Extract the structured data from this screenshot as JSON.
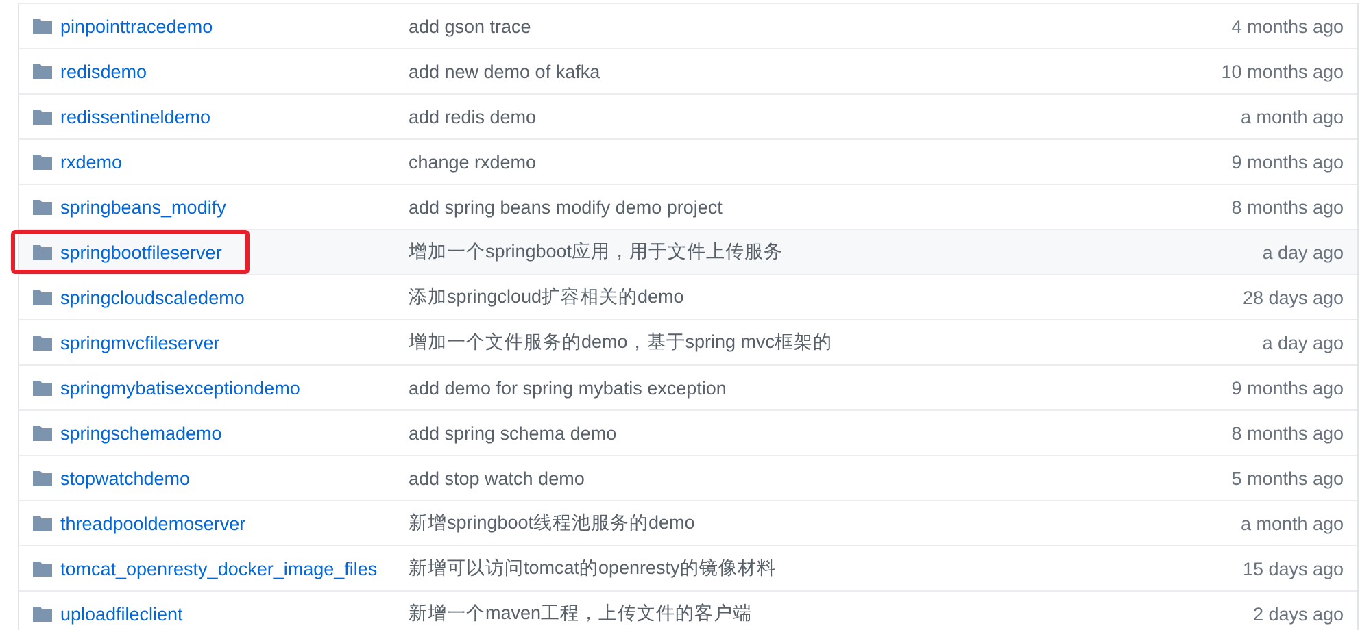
{
  "files": [
    {
      "name": "pinpointtracedemo",
      "message": "add gson trace",
      "age": "4 months ago",
      "highlighted": false,
      "boxed": false
    },
    {
      "name": "redisdemo",
      "message": "add new demo of kafka",
      "age": "10 months ago",
      "highlighted": false,
      "boxed": false
    },
    {
      "name": "redissentineldemo",
      "message": "add redis demo",
      "age": "a month ago",
      "highlighted": false,
      "boxed": false
    },
    {
      "name": "rxdemo",
      "message": "change rxdemo",
      "age": "9 months ago",
      "highlighted": false,
      "boxed": false
    },
    {
      "name": "springbeans_modify",
      "message": "add spring beans modify demo project",
      "age": "8 months ago",
      "highlighted": false,
      "boxed": false
    },
    {
      "name": "springbootfileserver",
      "message": "增加一个springboot应用，用于文件上传服务",
      "age": "a day ago",
      "highlighted": true,
      "boxed": true
    },
    {
      "name": "springcloudscaledemo",
      "message": "添加springcloud扩容相关的demo",
      "age": "28 days ago",
      "highlighted": false,
      "boxed": false
    },
    {
      "name": "springmvcfileserver",
      "message": "增加一个文件服务的demo，基于spring mvc框架的",
      "age": "a day ago",
      "highlighted": false,
      "boxed": false
    },
    {
      "name": "springmybatisexceptiondemo",
      "message": "add demo for spring mybatis exception",
      "age": "9 months ago",
      "highlighted": false,
      "boxed": false
    },
    {
      "name": "springschemademo",
      "message": "add spring schema demo",
      "age": "8 months ago",
      "highlighted": false,
      "boxed": false
    },
    {
      "name": "stopwatchdemo",
      "message": "add stop watch demo",
      "age": "5 months ago",
      "highlighted": false,
      "boxed": false
    },
    {
      "name": "threadpooldemoserver",
      "message": "新增springboot线程池服务的demo",
      "age": "a month ago",
      "highlighted": false,
      "boxed": false
    },
    {
      "name": "tomcat_openresty_docker_image_files",
      "message": "新增可以访问tomcat的openresty的镜像材料",
      "age": "15 days ago",
      "highlighted": false,
      "boxed": false
    },
    {
      "name": "uploadfileclient",
      "message": "新增一个maven工程，上传文件的客户端",
      "age": "2 days ago",
      "highlighted": false,
      "boxed": false
    }
  ]
}
